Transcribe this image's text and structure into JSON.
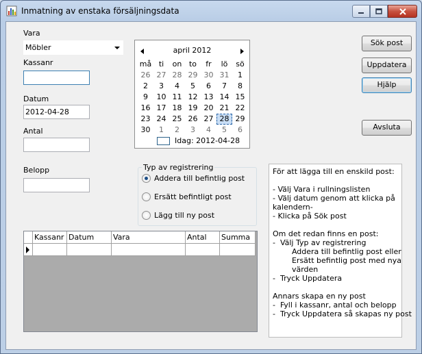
{
  "window": {
    "title": "Inmatning av enstaka försäljningsdata"
  },
  "form": {
    "vara_label": "Vara",
    "vara_value": "Möbler",
    "kassanr_label": "Kassanr",
    "kassanr_value": "",
    "datum_label": "Datum",
    "datum_value": "2012-04-28",
    "antal_label": "Antal",
    "antal_value": "",
    "belopp_label": "Belopp",
    "belopp_value": ""
  },
  "calendar": {
    "month_label": "april 2012",
    "weekdays": [
      "må",
      "ti",
      "on",
      "to",
      "fr",
      "lö",
      "sö"
    ],
    "weeks": [
      [
        "26",
        "27",
        "28",
        "29",
        "30",
        "31",
        "1"
      ],
      [
        "2",
        "3",
        "4",
        "5",
        "6",
        "7",
        "8"
      ],
      [
        "9",
        "10",
        "11",
        "12",
        "13",
        "14",
        "15"
      ],
      [
        "16",
        "17",
        "18",
        "19",
        "20",
        "21",
        "22"
      ],
      [
        "23",
        "24",
        "25",
        "26",
        "27",
        "28",
        "29"
      ],
      [
        "30",
        "1",
        "2",
        "3",
        "4",
        "5",
        "6"
      ]
    ],
    "today_text": "Idag: 2012-04-28"
  },
  "registration": {
    "group_title": "Typ av registrering",
    "options": [
      "Addera till befintlig post",
      "Ersätt befintligt post",
      "Lägg till ny post"
    ],
    "selected": 0
  },
  "buttons": {
    "sok_post": "Sök post",
    "uppdatera": "Uppdatera",
    "hjalp": "Hjälp",
    "avsluta": "Avsluta"
  },
  "grid": {
    "columns": [
      "Kassanr",
      "Datum",
      "Vara",
      "Antal",
      "Summa"
    ]
  },
  "help_text": [
    "För att lägga till en enskild post:",
    "",
    "- Välj Vara i rullningslisten",
    "- Välj datum genom att klicka på",
    "kalendern-",
    "- Klicka på Sök post",
    "",
    "Om det redan finns en post:",
    "-  Välj Typ av registrering",
    "        Addera till befintlig post eller",
    "        Ersätt befintlig post med nya",
    "        värden",
    "-  Tryck Uppdatera",
    "",
    "Annars skapa en ny post",
    "-  Fyll i kassanr, antal och belopp",
    "-  Tryck Uppdatera så skapas ny post"
  ]
}
